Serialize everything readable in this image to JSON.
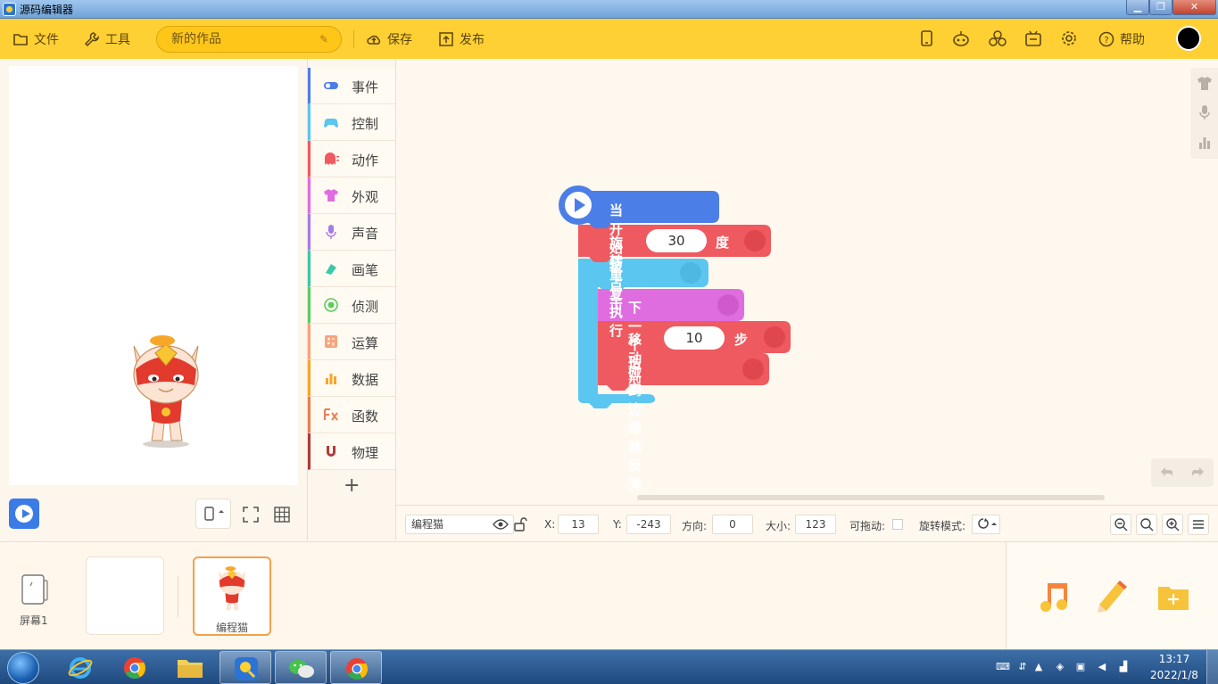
{
  "window": {
    "title": "源码编辑器",
    "min_glyph": "▁",
    "max_glyph": "❐",
    "close_glyph": "✕"
  },
  "toolbar": {
    "file_label": "文件",
    "tools_label": "工具",
    "project_name": "新的作品",
    "save_label": "保存",
    "publish_label": "发布",
    "help_label": "帮助",
    "right_icons": [
      "phone-preview-icon",
      "robot-icon",
      "extensions-icon",
      "gift-box-icon",
      "settings-gear-icon"
    ]
  },
  "categories": [
    {
      "label": "事件",
      "color": "#4c7ee8",
      "icon": "toggle-icon"
    },
    {
      "label": "控制",
      "color": "#5bc6f0",
      "icon": "gamepad-icon"
    },
    {
      "label": "动作",
      "color": "#ee5a5f",
      "icon": "ghost-icon"
    },
    {
      "label": "外观",
      "color": "#e06ddf",
      "icon": "shirt-icon"
    },
    {
      "label": "声音",
      "color": "#a77be8",
      "icon": "microphone-icon"
    },
    {
      "label": "画笔",
      "color": "#39c9a8",
      "icon": "pen-icon"
    },
    {
      "label": "侦测",
      "color": "#5ccc61",
      "icon": "radar-icon"
    },
    {
      "label": "运算",
      "color": "#f5a47b",
      "icon": "calculator-icon"
    },
    {
      "label": "数据",
      "color": "#f3a62b",
      "icon": "bar-chart-icon"
    },
    {
      "label": "函数",
      "color": "#e87f52",
      "icon": "function-icon"
    },
    {
      "label": "物理",
      "color": "#b03a3a",
      "icon": "magnet-icon"
    }
  ],
  "category_add_label": "+",
  "blocks": {
    "hat": {
      "text": "当 开始 被点击",
      "color": "#4c7ee8"
    },
    "rotate": {
      "prefix": "旋转",
      "value": "30",
      "suffix": "度",
      "color": "#ee5a5f"
    },
    "repeat": {
      "text": "重复执行",
      "color": "#5bc6f0"
    },
    "next_costume": {
      "text": "下一个 造型",
      "color": "#e06ddf"
    },
    "move": {
      "prefix": "移动",
      "value": "10",
      "suffix": "步",
      "color": "#ee5a5f"
    },
    "bounce": {
      "text": "碰到边缘就反弹",
      "color": "#ee5a5f"
    }
  },
  "properties": {
    "sprite_name": "编程猫",
    "x_label": "X:",
    "x_value": "13",
    "y_label": "Y:",
    "y_value": "-243",
    "direction_label": "方向:",
    "direction_value": "0",
    "size_label": "大小:",
    "size_value": "123",
    "draggable_label": "可拖动:",
    "rotation_mode_label": "旋转模式:"
  },
  "tray": {
    "screen_label": "屏幕1",
    "sprite_label": "编程猫"
  },
  "taskbar": {
    "time": "13:17",
    "date": "2022/1/8"
  }
}
